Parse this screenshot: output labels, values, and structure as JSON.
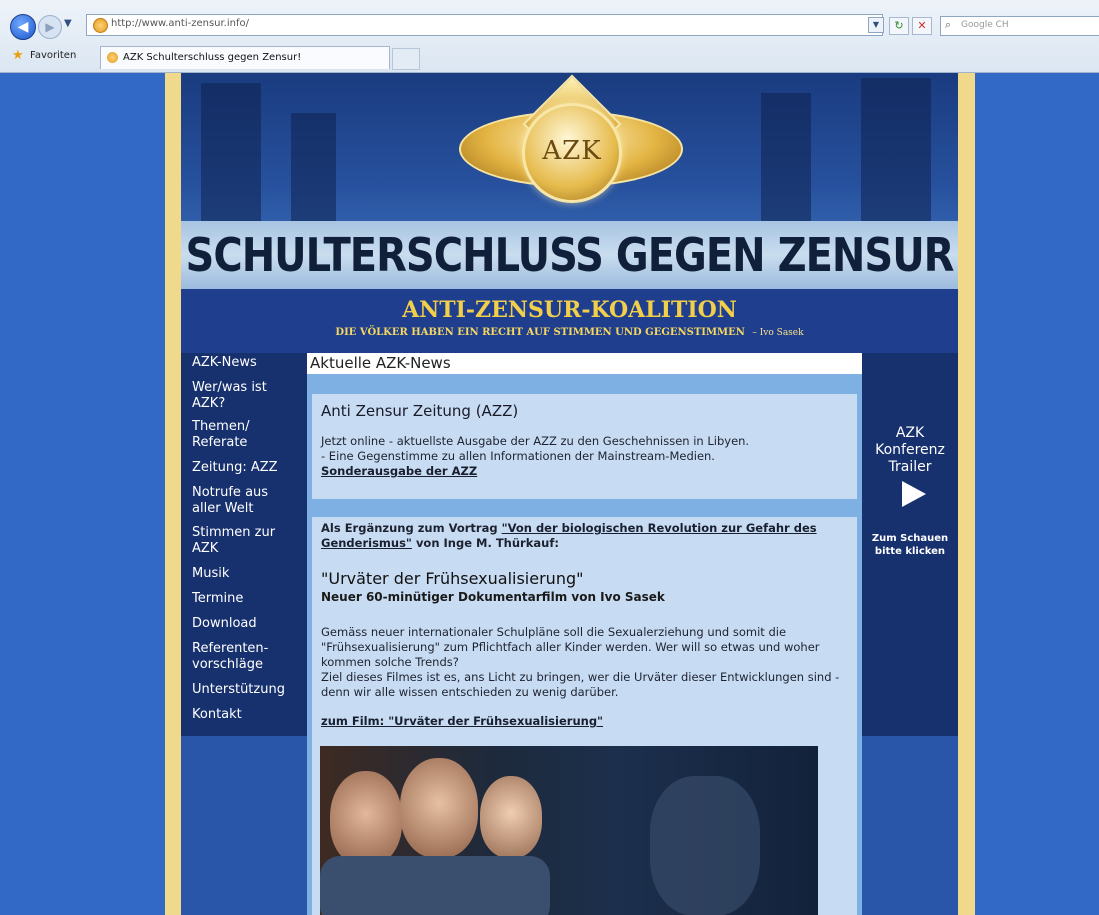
{
  "browser": {
    "url": "http://www.anti-zensur.info/",
    "search_placeholder": "Google CH",
    "favorites_label": "Favoriten",
    "tab_title": "AZK Schulterschluss gegen Zensur!"
  },
  "header": {
    "logo_text": "AZK",
    "title": "SCHULTERSCHLUSS GEGEN ZENSUR",
    "koalition": "ANTI-ZENSUR-KOALITION",
    "slogan": "DIE VÖLKER HABEN EIN RECHT AUF STIMMEN UND GEGENSTIMMEN",
    "slogan_author": "– Ivo Sasek"
  },
  "nav": {
    "items": [
      "AZK-News",
      "Wer/was ist AZK?",
      "Themen/ Referate",
      "Zeitung: AZZ",
      "Notrufe aus aller Welt",
      "Stimmen zur AZK",
      "Musik",
      "Termine",
      "Download",
      "Referenten-vorschläge",
      "Unterstützung",
      "Kontakt"
    ]
  },
  "content": {
    "title": "Aktuelle AZK-News",
    "azz": {
      "title": "Anti Zensur Zeitung (AZZ)",
      "line1": "Jetzt online - aktuellste Ausgabe der AZZ zu den Geschehnissen in Libyen.",
      "line2": "- Eine Gegenstimme zu allen Informationen der Mainstream-Medien.",
      "link": "Sonderausgabe der AZZ"
    },
    "article": {
      "intro_prefix": "Als Ergänzung zum Vortrag",
      "intro_link": "\"Von der biologischen Revolution zur Gefahr des Genderismus\"",
      "intro_suffix": "von Inge M. Thürkauf:",
      "film_title": "\"Urväter der Frühsexualisierung\"",
      "film_sub": "Neuer 60-minütiger Dokumentarfilm von Ivo Sasek",
      "para1": "Gemäss neuer internationaler Schulpläne soll die Sexualerziehung und somit die \"Frühsexualisierung\" zum Pflichtfach aller Kinder werden. Wer will so etwas und woher kommen solche Trends?",
      "para2": "Ziel dieses Filmes ist es, ans Licht zu bringen, wer die Urväter dieser Entwicklungen sind - denn wir alle wissen entschieden zu wenig darüber.",
      "film_link": "zum Film: \"Urväter der Frühsexualisierung\""
    }
  },
  "right": {
    "trailer_label": "AZK Konferenz Trailer",
    "trailer_note": "Zum Schauen bitte klicken"
  },
  "colors": {
    "page_bg": "#2f64c4",
    "nav_bg": "#17306e",
    "content_bg": "#7fb0e4",
    "box_bg": "#c7dcf2",
    "frame_gold": "#f0d98a",
    "accent_gold": "#f2cf4a"
  }
}
